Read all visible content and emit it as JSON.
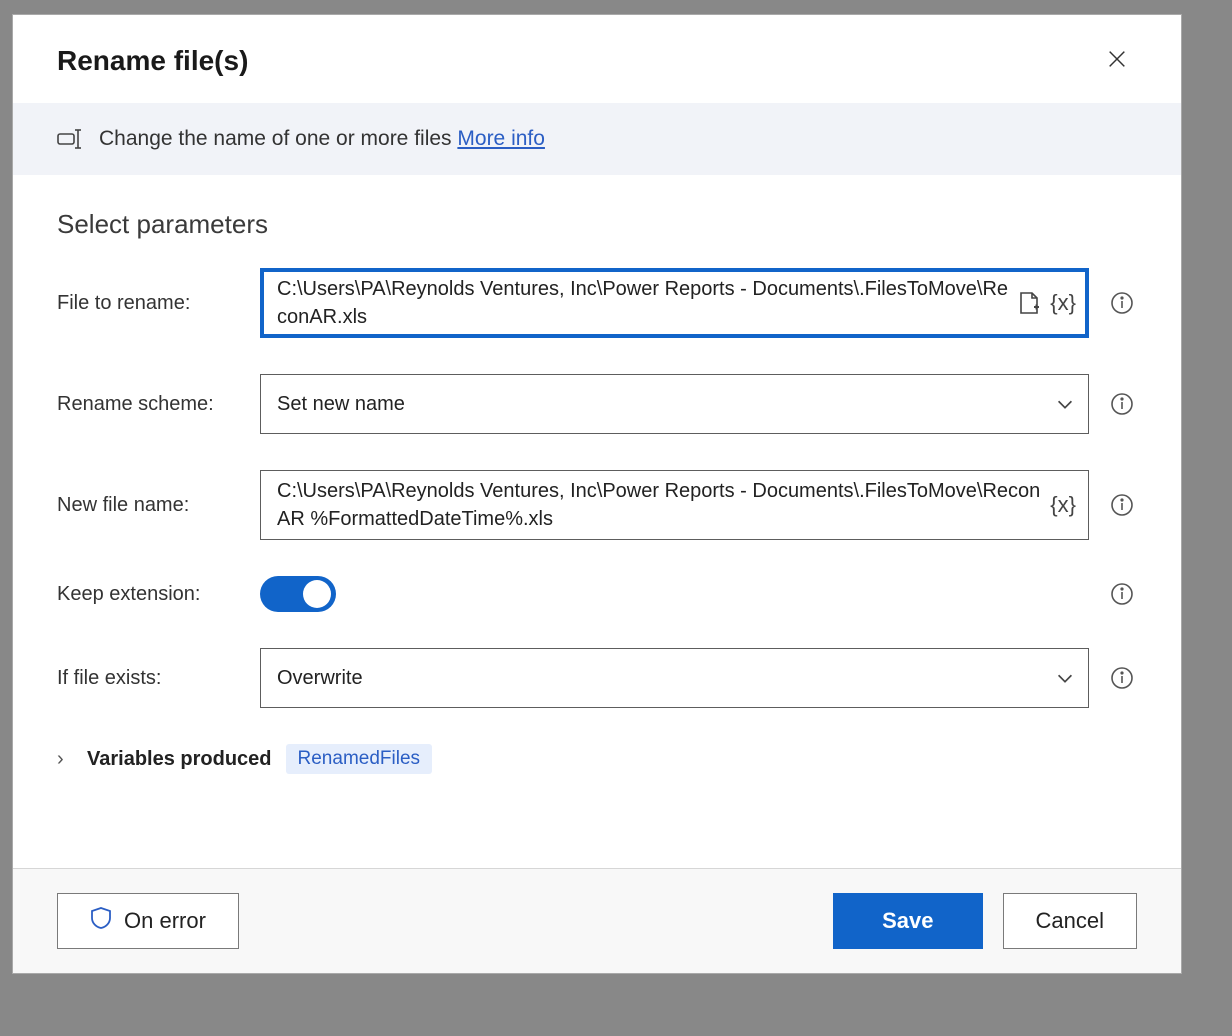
{
  "dialog": {
    "title": "Rename file(s)",
    "description": "Change the name of one or more files",
    "more_info": "More info"
  },
  "section": {
    "title": "Select parameters"
  },
  "fields": {
    "file_to_rename": {
      "label": "File to rename:",
      "value": "C:\\Users\\PA\\Reynolds Ventures, Inc\\Power Reports - Documents\\.FilesToMove\\ReconAR.xls"
    },
    "rename_scheme": {
      "label": "Rename scheme:",
      "value": "Set new name"
    },
    "new_file_name": {
      "label": "New file name:",
      "value": "C:\\Users\\PA\\Reynolds Ventures, Inc\\Power Reports - Documents\\.FilesToMove\\ReconAR %FormattedDateTime%.xls"
    },
    "keep_extension": {
      "label": "Keep extension:",
      "value": true
    },
    "if_file_exists": {
      "label": "If file exists:",
      "value": "Overwrite"
    }
  },
  "variables": {
    "label": "Variables produced",
    "chip": "RenamedFiles"
  },
  "footer": {
    "on_error": "On error",
    "save": "Save",
    "cancel": "Cancel"
  },
  "glyphs": {
    "var": "{x}",
    "chevron_right": "›"
  }
}
